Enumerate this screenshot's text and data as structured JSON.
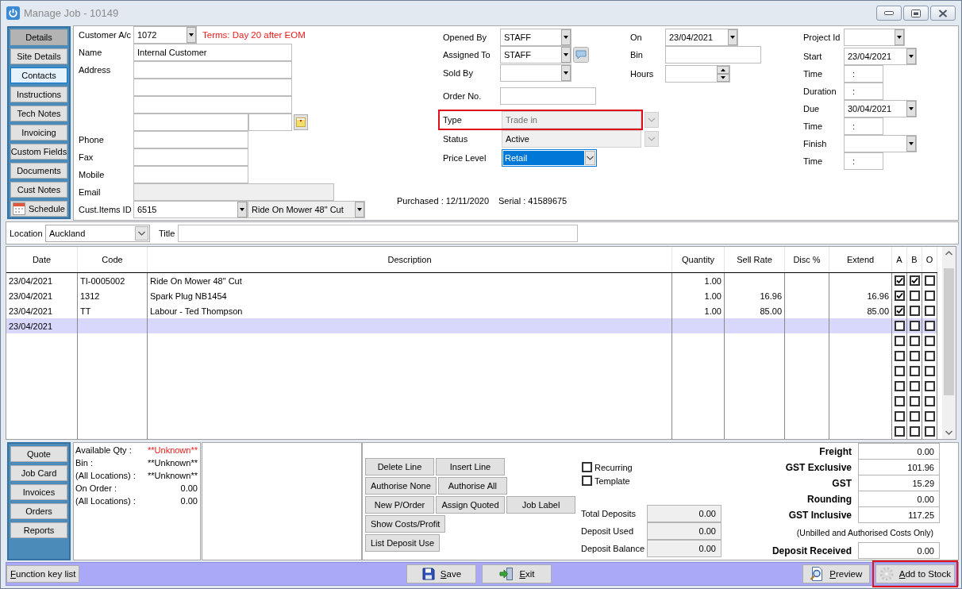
{
  "window": {
    "title": "Manage Job - 10149"
  },
  "sidebar": {
    "tabs": [
      {
        "label": "Details",
        "kind": "text",
        "selected": true,
        "focused": false
      },
      {
        "label": "Site Details",
        "kind": "text",
        "selected": false,
        "focused": false
      },
      {
        "label": "Contacts",
        "kind": "text",
        "selected": false,
        "focused": true
      },
      {
        "label": "Instructions",
        "kind": "text",
        "selected": false,
        "focused": false
      },
      {
        "label": "Tech Notes",
        "kind": "text",
        "selected": false,
        "focused": false
      },
      {
        "label": "Invoicing",
        "kind": "text",
        "selected": false,
        "focused": false
      },
      {
        "label": "Custom Fields",
        "kind": "text",
        "selected": false,
        "focused": false
      },
      {
        "label": "Documents",
        "kind": "text",
        "selected": false,
        "focused": false
      },
      {
        "label": "Cust Notes",
        "kind": "text",
        "selected": false,
        "focused": false
      },
      {
        "label": "Schedule",
        "kind": "calendar",
        "selected": false,
        "focused": false
      }
    ]
  },
  "customer": {
    "account": {
      "label": "Customer A/c",
      "value": "1072"
    },
    "terms": "Terms: Day 20 after EOM",
    "name": {
      "label": "Name",
      "value": "Internal Customer"
    },
    "address": {
      "label": "Address"
    },
    "phone": {
      "label": "Phone"
    },
    "fax": {
      "label": "Fax"
    },
    "mobile": {
      "label": "Mobile"
    },
    "email": {
      "label": "Email",
      "disabled": true
    },
    "cust_items": {
      "label": "Cust.Items ID",
      "value": "6515",
      "item": "Ride On Mower 48\" Cut"
    }
  },
  "job": {
    "people": [
      {
        "label": "Opened By",
        "kind": "combo",
        "value": "STAFF",
        "message_button": false
      },
      {
        "label": "Assigned To",
        "kind": "combo",
        "value": "STAFF",
        "message_button": true
      },
      {
        "label": "Sold By",
        "kind": "combo",
        "message_button": false
      },
      {
        "label": "Order No.",
        "kind": "text",
        "message_button": false
      }
    ],
    "timing": [
      {
        "label": "On",
        "kind": "date",
        "value": "23/04/2021"
      },
      {
        "label": "Bin",
        "kind": "text"
      },
      {
        "label": "Hours",
        "kind": "spinner"
      }
    ],
    "classification": [
      {
        "label": "Type",
        "kind": "list",
        "value": "Trade in",
        "disabled": true,
        "focused": false,
        "highlighted": true
      },
      {
        "label": "Status",
        "kind": "list",
        "value": "Active",
        "disabled": false,
        "focused": false,
        "highlighted": false
      },
      {
        "label": "Price Level",
        "kind": "combo",
        "value": "Retail",
        "disabled": false,
        "focused": true,
        "highlighted": false
      }
    ],
    "purchased": "Purchased : 12/11/2020",
    "serial": "Serial : 41589675"
  },
  "project": [
    {
      "label": "Project Id",
      "kind": "lookup"
    },
    {
      "label": "Start",
      "kind": "date",
      "value": "23/04/2021"
    },
    {
      "label": "Time",
      "kind": "time",
      "value": ":"
    },
    {
      "label": "Duration",
      "kind": "time",
      "value": ":"
    },
    {
      "label": "Due",
      "kind": "date",
      "value": "30/04/2021"
    },
    {
      "label": "Time",
      "kind": "time",
      "value": ":"
    },
    {
      "label": "Finish",
      "kind": "date"
    },
    {
      "label": "Time",
      "kind": "time",
      "value": ":"
    }
  ],
  "location": {
    "label": "Location",
    "value": "Auckland"
  },
  "title": {
    "label": "Title"
  },
  "table": {
    "columns": [
      "Date",
      "Code",
      "Description",
      "Quantity",
      "Sell Rate",
      "Disc %",
      "Extend",
      "A",
      "B",
      "O"
    ],
    "rows": [
      {
        "date": "23/04/2021",
        "code": "TI-0005002",
        "description": "Ride On Mower 48\" Cut",
        "quantity": "1.00",
        "a": true,
        "b": true,
        "o": false,
        "selected": false
      },
      {
        "date": "23/04/2021",
        "code": "1312",
        "description": "Spark Plug NB1454",
        "quantity": "1.00",
        "sell_rate": "16.96",
        "extend": "16.96",
        "a": true,
        "b": false,
        "o": false,
        "selected": false
      },
      {
        "date": "23/04/2021",
        "code": "TT",
        "description": "Labour - Ted Thompson",
        "quantity": "1.00",
        "sell_rate": "85.00",
        "extend": "85.00",
        "a": true,
        "b": false,
        "o": false,
        "selected": false
      },
      {
        "date": "23/04/2021",
        "a": false,
        "b": false,
        "o": false,
        "selected": true
      },
      {
        "a": false,
        "b": false,
        "o": false,
        "selected": false
      },
      {
        "a": false,
        "b": false,
        "o": false,
        "selected": false
      },
      {
        "a": false,
        "b": false,
        "o": false,
        "selected": false
      },
      {
        "a": false,
        "b": false,
        "o": false,
        "selected": false
      },
      {
        "a": false,
        "b": false,
        "o": false,
        "selected": false
      },
      {
        "a": false,
        "b": false,
        "o": false,
        "selected": false
      },
      {
        "a": false,
        "b": false,
        "o": false,
        "selected": false
      }
    ]
  },
  "job_menu": [
    "Quote",
    "Job Card",
    "Invoices",
    "Orders",
    "Reports"
  ],
  "stock": [
    {
      "label": "Available Qty :",
      "value": "**Unknown**",
      "alert": true
    },
    {
      "label": "Bin :",
      "value": "**Unknown**",
      "alert": false
    },
    {
      "label": "(All Locations) :",
      "value": "**Unknown**",
      "alert": false
    },
    {
      "label": "On Order :",
      "value": "0.00",
      "alert": false
    },
    {
      "label": "(All Locations) :",
      "value": "0.00",
      "alert": false
    }
  ],
  "line_buttons": [
    [
      "Delete Line",
      "Insert Line"
    ],
    [
      "Authorise None",
      "Authorise All"
    ],
    [
      "New P/Order",
      "Assign Quoted",
      "Job Label"
    ],
    [
      "Show Costs/Profit"
    ],
    [
      "List Deposit Use"
    ]
  ],
  "options": [
    {
      "label": "Recurring",
      "checked": false
    },
    {
      "label": "Template",
      "checked": false
    }
  ],
  "deposits": [
    {
      "label": "Total Deposits",
      "value": "0.00"
    },
    {
      "label": "Deposit Used",
      "value": "0.00"
    },
    {
      "label": "Deposit Balance",
      "value": "0.00"
    }
  ],
  "totals": [
    {
      "label": "Freight",
      "value": "0.00"
    },
    {
      "label": "GST Exclusive",
      "value": "101.96"
    },
    {
      "label": "GST",
      "value": "15.29"
    },
    {
      "label": "Rounding",
      "value": "0.00"
    },
    {
      "label": "GST Inclusive",
      "value": "117.25"
    }
  ],
  "totals_note": "(Unbilled and Authorised Costs Only)",
  "deposit_received": {
    "label": "Deposit Received",
    "value": "0.00"
  },
  "footer": {
    "left": [
      {
        "label": "Function key list",
        "kind": "plain",
        "mnemonic": true,
        "highlighted": false
      }
    ],
    "center": [
      {
        "label": "Save",
        "kind": "save",
        "mnemonic": true,
        "highlighted": false
      },
      {
        "label": "Exit",
        "kind": "exit",
        "mnemonic": true,
        "highlighted": false
      }
    ],
    "right": [
      {
        "label": "Preview",
        "kind": "preview",
        "mnemonic": true,
        "highlighted": false
      },
      {
        "label": "Add to Stock",
        "kind": "stock",
        "mnemonic": true,
        "highlighted": true
      }
    ]
  }
}
